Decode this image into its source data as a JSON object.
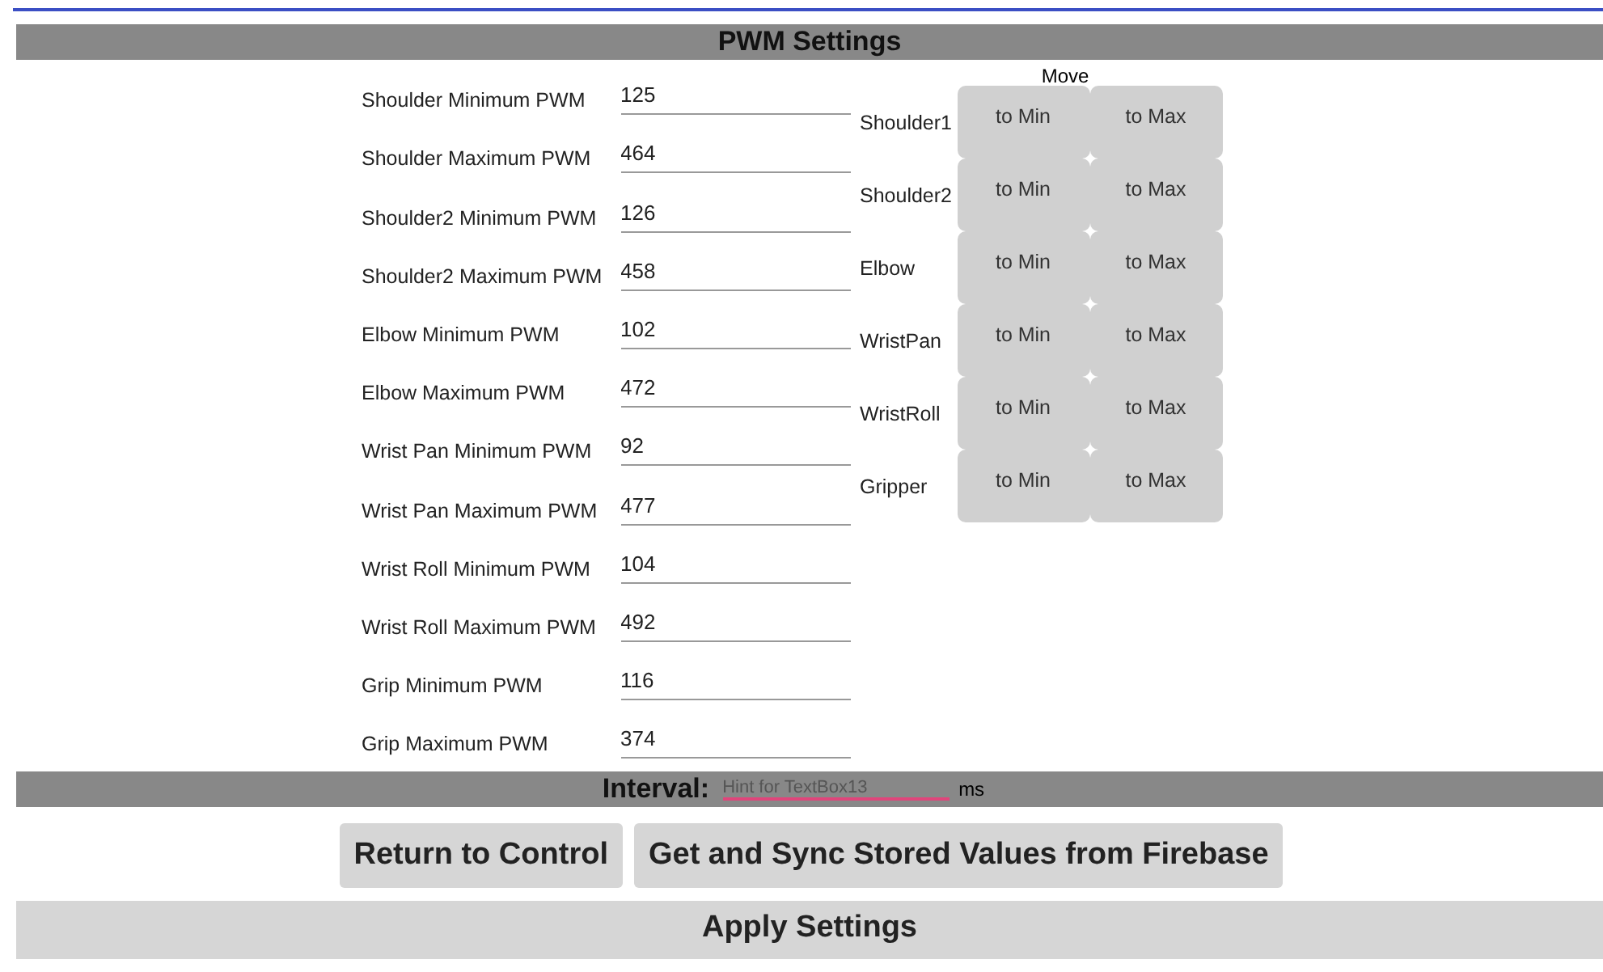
{
  "header": {
    "title": "PWM Settings"
  },
  "pwm_fields": [
    {
      "label": "Shoulder Minimum PWM",
      "value": "125"
    },
    {
      "label": "Shoulder Maximum PWM",
      "value": "464"
    },
    {
      "label": "Shoulder2 Minimum PWM",
      "value": "126"
    },
    {
      "label": "Shoulder2 Maximum PWM",
      "value": "458"
    },
    {
      "label": "Elbow Minimum PWM",
      "value": "102"
    },
    {
      "label": "Elbow Maximum PWM",
      "value": "472"
    },
    {
      "label": "Wrist Pan Minimum PWM",
      "value": "92"
    },
    {
      "label": "Wrist Pan Maximum PWM",
      "value": "477"
    },
    {
      "label": "Wrist Roll Minimum PWM",
      "value": "104"
    },
    {
      "label": "Wrist Roll Maximum PWM",
      "value": "492"
    },
    {
      "label": "Grip Minimum PWM",
      "value": "116"
    },
    {
      "label": "Grip Maximum PWM",
      "value": "374"
    }
  ],
  "move": {
    "heading": "Move",
    "joints": [
      {
        "name": "Shoulder1",
        "min_button": "to Min",
        "max_button": "to Max"
      },
      {
        "name": "Shoulder2",
        "min_button": "to Min",
        "max_button": "to Max"
      },
      {
        "name": "Elbow",
        "min_button": "to Min",
        "max_button": "to Max"
      },
      {
        "name": "WristPan",
        "min_button": "to Min",
        "max_button": "to Max"
      },
      {
        "name": "WristRoll",
        "min_button": "to Min",
        "max_button": "to Max"
      },
      {
        "name": "Gripper",
        "min_button": "to Min",
        "max_button": "to Max"
      }
    ]
  },
  "interval": {
    "label": "Interval:",
    "placeholder": "Hint for TextBox13",
    "unit": "ms"
  },
  "buttons": [
    "Return to Control",
    "Get and Sync Stored Values from Firebase"
  ],
  "apply_button": "Apply Settings"
}
